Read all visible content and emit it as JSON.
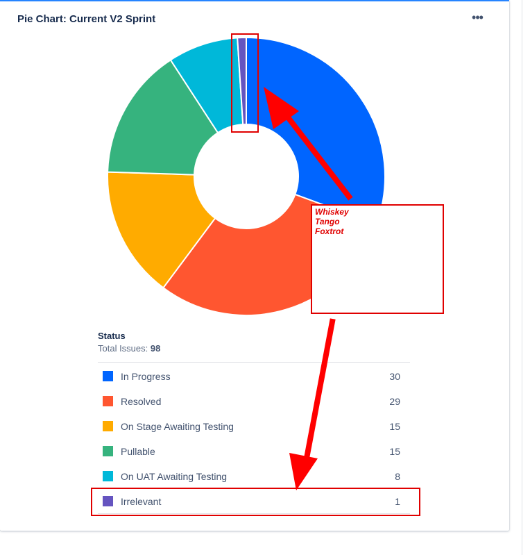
{
  "header": {
    "title": "Pie Chart: Current V2 Sprint",
    "menu_label": "•••"
  },
  "legend": {
    "heading": "Status",
    "total_label": "Total Issues: ",
    "total_value": "98"
  },
  "annotation": {
    "note": "Whiskey\nTango\nFoxtrot"
  },
  "chart_data": {
    "type": "pie",
    "donut": true,
    "categories": [
      "In Progress",
      "Resolved",
      "On Stage Awaiting Testing",
      "Pullable",
      "On UAT Awaiting Testing",
      "Irrelevant"
    ],
    "values": [
      30,
      29,
      15,
      15,
      8,
      1
    ],
    "colors": [
      "#0065ff",
      "#ff5630",
      "#ffab00",
      "#36b37e",
      "#00b8d9",
      "#6554c0"
    ],
    "total": 98,
    "legend_position": "bottom"
  }
}
